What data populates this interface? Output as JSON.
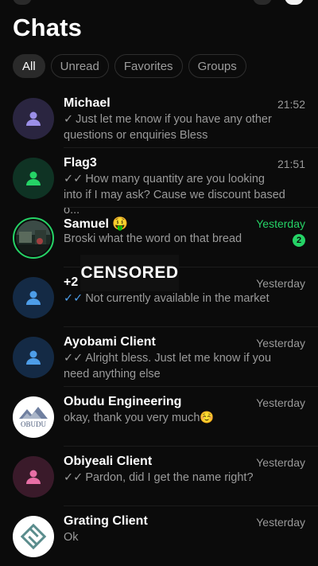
{
  "header": {
    "title": "Chats"
  },
  "filters": [
    {
      "label": "All",
      "active": true
    },
    {
      "label": "Unread",
      "active": false
    },
    {
      "label": "Favorites",
      "active": false
    },
    {
      "label": "Groups",
      "active": false
    }
  ],
  "chats": [
    {
      "name": "Michael",
      "time": "21:52",
      "tick": "✓",
      "message": "Just let me know if you have any other questions or enquiries  Bless",
      "avatar": "person-icon",
      "avatar_color": "#9b8fe8",
      "avatar_bg": "#2a2540"
    },
    {
      "name": "Flag3",
      "time": "21:51",
      "tick": "✓✓",
      "message": "How many quantity are you looking into if I may ask? Cause we discount based o...",
      "avatar": "person-icon",
      "avatar_color": "#25d366",
      "avatar_bg": "#0f3324"
    },
    {
      "name": "Samuel 🤑",
      "time": "Yesterday",
      "message": "Broski what the word on that bread",
      "unread_count": "2",
      "avatar": "photo-avatar"
    },
    {
      "name": "+2",
      "name_suffix": "2",
      "time": "Yesterday",
      "tick": "✓✓",
      "message": "Not currently available in the market",
      "avatar": "person-icon",
      "avatar_color": "#4d9de8",
      "avatar_bg": "#142a45"
    },
    {
      "name": "Ayobami Client",
      "time": "Yesterday",
      "tick": "✓✓",
      "message": "Alright bless. Just let me know if you need anything else",
      "avatar": "person-icon",
      "avatar_color": "#4d9de8",
      "avatar_bg": "#142a45"
    },
    {
      "name": "Obudu Engineering",
      "time": "Yesterday",
      "message": "okay, thank you very much☺️",
      "avatar": "logo-avatar",
      "logo_text": "OBUDU"
    },
    {
      "name": "Obiyeali Client",
      "time": "Yesterday",
      "tick": "✓✓",
      "message": "Pardon, did I get the name right?",
      "avatar": "person-icon",
      "avatar_color": "#e86fa6",
      "avatar_bg": "#3a1a2a"
    },
    {
      "name": "Grating Client",
      "time": "Yesterday",
      "message": "Ok",
      "avatar": "logo-avatar"
    }
  ],
  "censor_label": "CENSORED",
  "colors": {
    "accent": "#25d366",
    "read_tick": "#4d9de8"
  }
}
